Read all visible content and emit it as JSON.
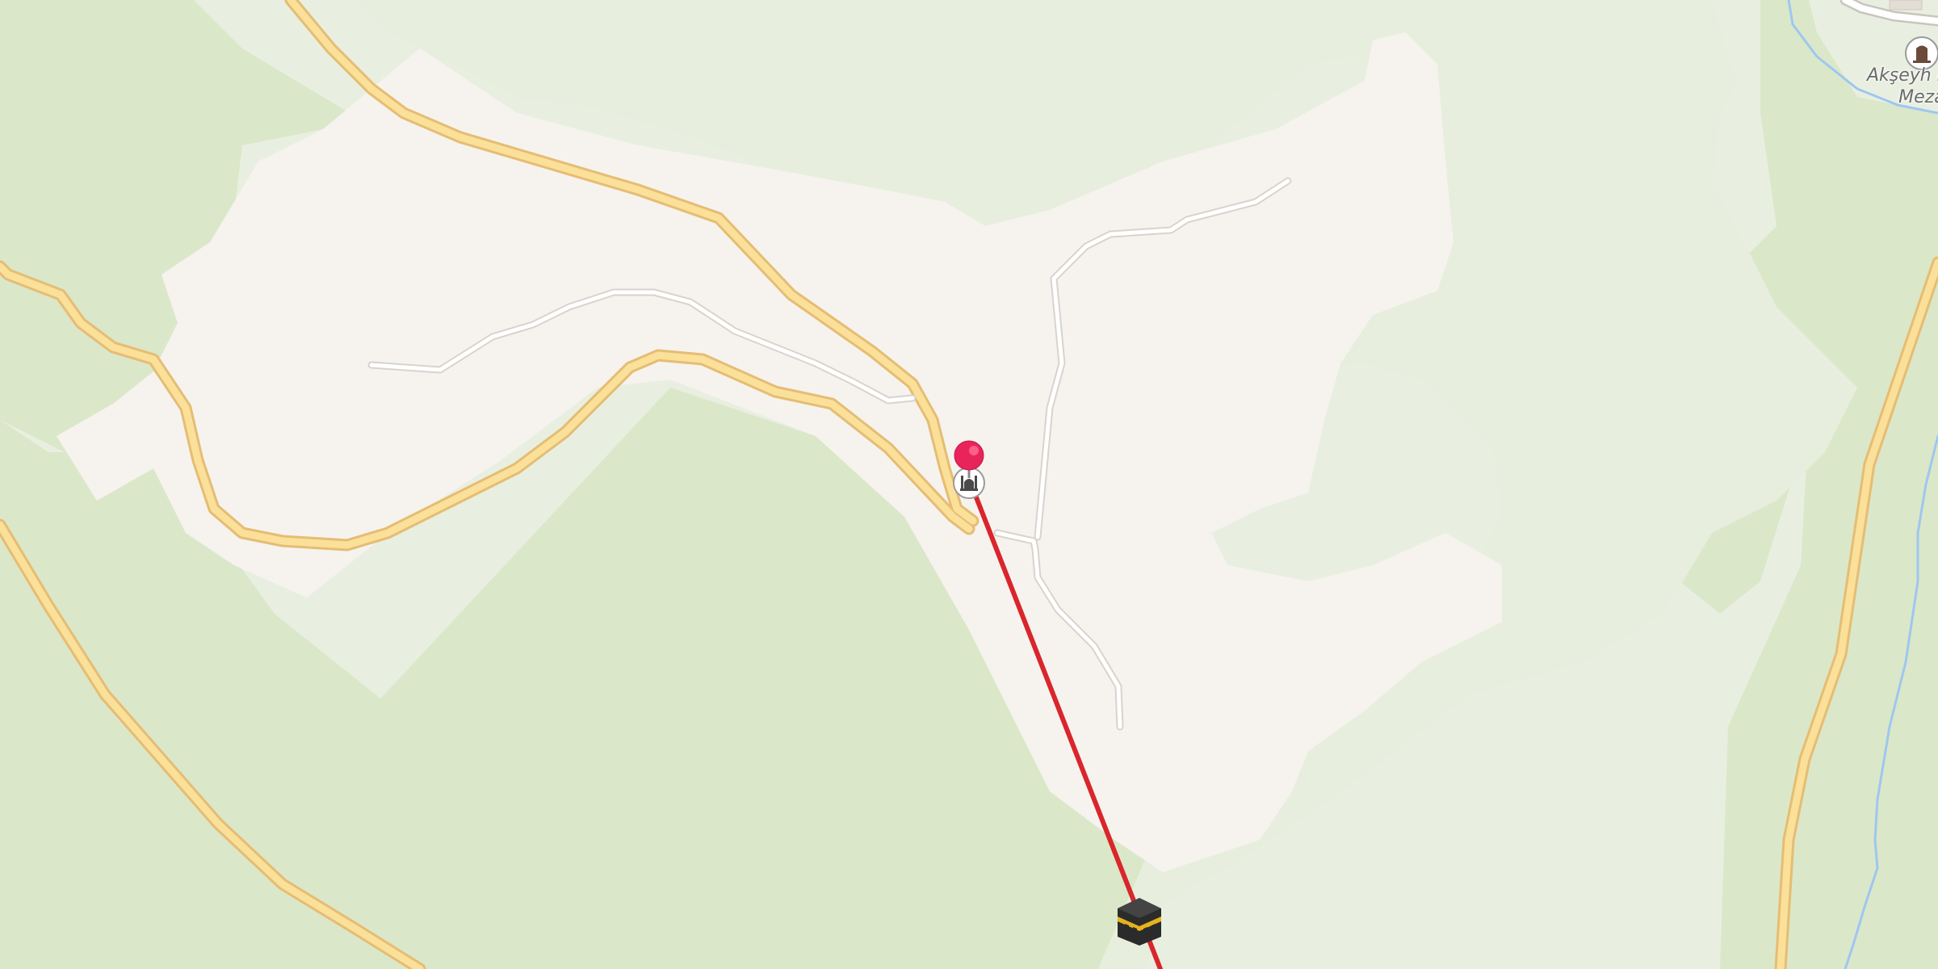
{
  "map": {
    "poi_labels": [
      {
        "line1": "Akşeyh M",
        "line2": "Mezar",
        "icon": "cemetery-icon"
      }
    ],
    "markers": [
      {
        "icon": "location-pin-icon",
        "color": "#e8245a"
      },
      {
        "icon": "mosque-icon"
      },
      {
        "icon": "kaaba-icon"
      }
    ],
    "qibla_line_color": "#d9262c",
    "colors": {
      "forest": "#dbe7c9",
      "open_land": "#e8eede",
      "residential": "#f6f3ef",
      "main_road": "#fbe09a",
      "main_road_casing": "#e5bd73",
      "minor_road": "#ffffff",
      "minor_road_casing": "#d8d3cc",
      "stream": "#9ec7f0"
    }
  }
}
